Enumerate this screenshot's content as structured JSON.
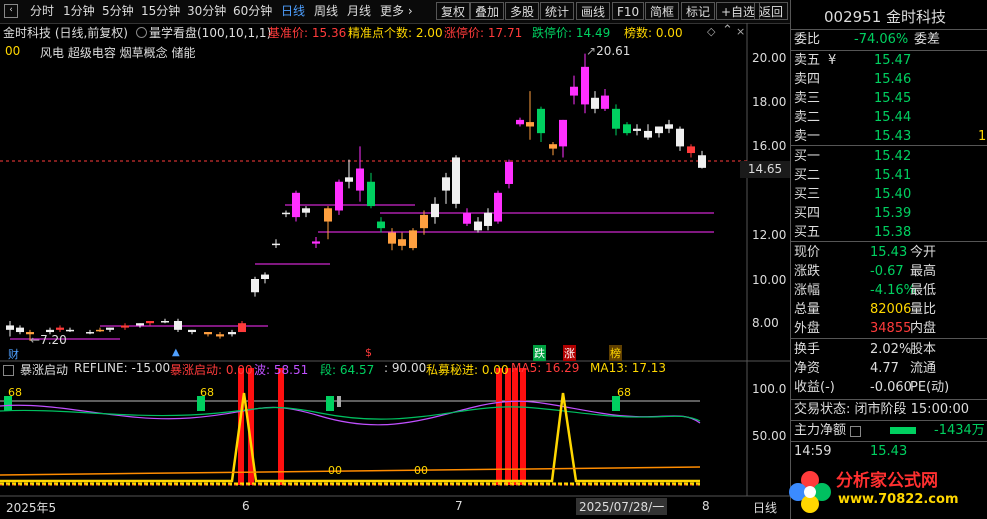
{
  "toolbar": {
    "periods": [
      "分时",
      "1分钟",
      "5分钟",
      "15分钟",
      "30分钟",
      "60分钟",
      "日线",
      "周线",
      "月线",
      "更多 ›"
    ],
    "active": "日线",
    "buttons": [
      "复权",
      "叠加",
      "多股",
      "统计",
      "画线",
      "F10",
      "简框",
      "标记",
      "+自选",
      "返回"
    ]
  },
  "main_header": {
    "stock": "金时科技 (日线,前复权)",
    "indicator_name": "量学看盘(100,10,1,1)",
    "base_price_label": "基准价: 15.36",
    "precise_points": "精准点个数: 2.00",
    "limit_up_label": "涨停价: 17.71",
    "limit_down_label": "跌停价: 14.49",
    "board_count": "榜数: 0.00",
    "line2_prefix": "00",
    "concepts": "风电  超级电容  烟草概念  储能"
  },
  "price_axis": [
    "20.00",
    "18.00",
    "16.00",
    "14.65",
    "12.00",
    "10.00",
    "8.00"
  ],
  "price_annotations": {
    "high": "20.61",
    "low": "7.20"
  },
  "markers": {
    "cai": "财",
    "die": "跌",
    "zhang": "涨",
    "bang": "榜",
    "dollar": "$"
  },
  "lower_header": {
    "name": "暴涨启动",
    "refline": "REFLINE: -15.00",
    "start": "暴涨启动: 0.00",
    "wave": "波: 58.51",
    "segment": "段: 64.57",
    "ninety": ": 90.00",
    "private": "私募秘进: 0.00",
    "ma5": "MA5: 16.29",
    "ma13": "MA13: 17.13"
  },
  "lower_axis": [
    "100.0",
    "50.00"
  ],
  "lower_labels": {
    "l68": "68",
    "l00": "00"
  },
  "date_axis": [
    "2025年5",
    "6",
    "7",
    "2025/07/28/一",
    "8"
  ],
  "date_axis_right": "日线",
  "side_panel": {
    "code": "002951",
    "name": "金时科技",
    "weibi_label": "委比",
    "weibi_value": "-74.06%",
    "weicha_label": "委差",
    "asks": [
      {
        "label": "卖五",
        "price": "15.47",
        "mark": "¥"
      },
      {
        "label": "卖四",
        "price": "15.46"
      },
      {
        "label": "卖三",
        "price": "15.45"
      },
      {
        "label": "卖二",
        "price": "15.44"
      },
      {
        "label": "卖一",
        "price": "15.43",
        "qty": "1"
      }
    ],
    "bids": [
      {
        "label": "买一",
        "price": "15.42"
      },
      {
        "label": "买二",
        "price": "15.41"
      },
      {
        "label": "买三",
        "price": "15.40"
      },
      {
        "label": "买四",
        "price": "15.39"
      },
      {
        "label": "买五",
        "price": "15.38"
      }
    ],
    "quote": [
      {
        "l": "现价",
        "v": "15.43",
        "r": "今开",
        "c": "green"
      },
      {
        "l": "涨跌",
        "v": "-0.67",
        "r": "最高",
        "c": "green"
      },
      {
        "l": "涨幅",
        "v": "-4.16%",
        "r": "最低",
        "c": "green"
      },
      {
        "l": "总量",
        "v": "82006",
        "r": "量比",
        "c": "yellow"
      },
      {
        "l": "外盘",
        "v": "34855",
        "r": "内盘",
        "c": "red"
      }
    ],
    "stats": [
      {
        "l": "换手",
        "v": "2.02%",
        "r": "股本"
      },
      {
        "l": "净资",
        "v": "4.77",
        "r": "流通"
      },
      {
        "l": "收益(-)",
        "v": "-0.060",
        "r": "PE(动)"
      }
    ],
    "trade_state": "交易状态: 闭市阶段 15:00:00",
    "main_flow_label": "主力净额",
    "main_flow_value": "-1434万",
    "last_time": "14:59",
    "last_price": "15.43"
  },
  "watermark": {
    "text": "分析家公式网",
    "url": "www.70822.com"
  },
  "colors": {
    "up": "#ff3b3b",
    "down": "#00d060",
    "accent": "#4fa0ff",
    "magenta": "#ff30ff"
  }
}
